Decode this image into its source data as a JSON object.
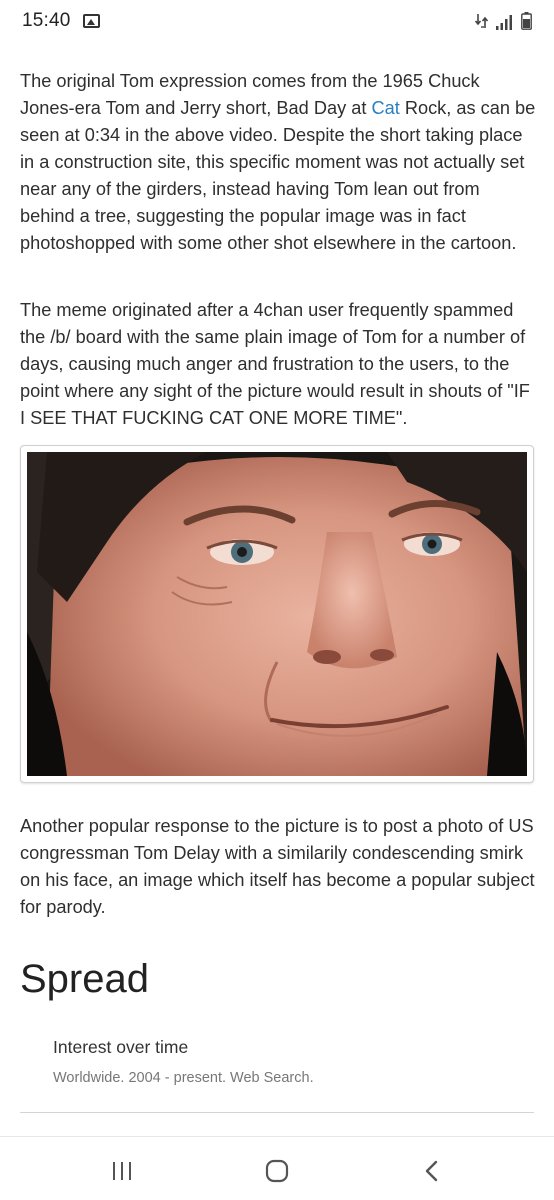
{
  "status_bar": {
    "time": "15:40",
    "icons": [
      "gallery-notification-icon",
      "data-transfer-icon",
      "signal-icon",
      "battery-icon"
    ]
  },
  "article": {
    "paragraph_1": {
      "before_link": "The original Tom expression comes from the 1965 Chuck Jones-era Tom and Jerry short, Bad Day at ",
      "link_text": "Cat",
      "after_link": " Rock, as can be seen at 0:34 in the above video. Despite the short taking place in a construction site, this specific moment was not actually set near any of the girders, instead having Tom lean out from behind a tree, suggesting the popular image was in fact photoshopped with some other shot elsewhere in the cartoon."
    },
    "paragraph_2": "The meme originated after a 4chan user frequently spammed the /b/ board with the same plain image of Tom for a number of days, causing much anger and frustration to the users, to the point where any sight of the picture would result in shouts of \"IF I SEE THAT FUCKING CAT ONE MORE TIME\".",
    "paragraph_3": "Another popular response to the picture is to post a photo of US congressman Tom Delay with a similarily condescending smirk on his face, an image which itself has become a popular subject for parody.",
    "section_heading": "Spread",
    "trends": {
      "title": "Interest over time",
      "subtitle": "Worldwide. 2004 - present. Web Search."
    }
  },
  "colors": {
    "link": "#2a7fc1",
    "text": "#2f2f2f"
  },
  "nav_bar": {
    "buttons": [
      "recent-apps",
      "home",
      "back"
    ]
  }
}
